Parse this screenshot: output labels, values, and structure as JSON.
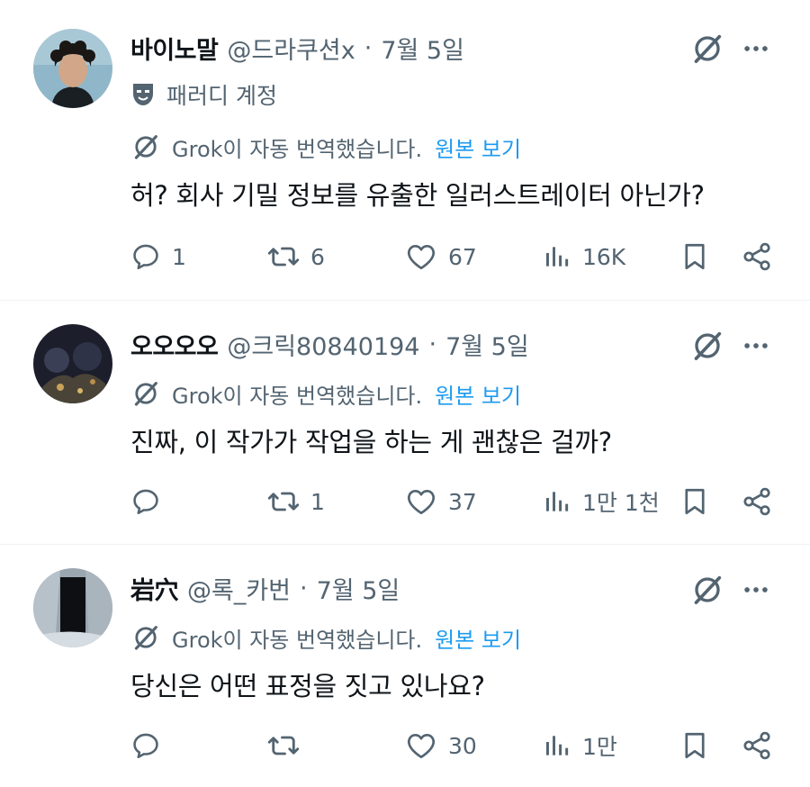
{
  "replies": [
    {
      "name": "바이노말",
      "handle": "@드라쿠션x",
      "dot": "·",
      "date": "7월 5일",
      "parody_label": "패러디 계정",
      "translate_note": "Grok이 자동 번역했습니다.",
      "view_original": "원본 보기",
      "text": "허? 회사 기밀 정보를 유출한 일러스트레이터 아닌가?",
      "replies_count": "1",
      "reposts_count": "6",
      "likes_count": "67",
      "views_count": "16K"
    },
    {
      "name": "오오오오",
      "handle": "@크릭80840194",
      "dot": "·",
      "date": "7월 5일",
      "translate_note": "Grok이 자동 번역했습니다.",
      "view_original": "원본 보기",
      "text": "진짜, 이 작가가 작업을 하는 게 괜찮은 걸까?",
      "replies_count": "",
      "reposts_count": "1",
      "likes_count": "37",
      "views_count": "1만 1천"
    },
    {
      "name": "岩穴",
      "handle": "@록_카번",
      "dot": "·",
      "date": "7월 5일",
      "translate_note": "Grok이 자동 번역했습니다.",
      "view_original": "원본 보기",
      "text": "당신은 어떤 표정을 짓고 있나요?",
      "replies_count": "",
      "reposts_count": "",
      "likes_count": "30",
      "views_count": "1만"
    }
  ],
  "icons": {
    "reply": "reply-icon",
    "repost": "repost-icon",
    "like": "heart-icon",
    "views": "views-icon",
    "bookmark": "bookmark-icon",
    "share": "share-icon",
    "grok": "grok-icon",
    "more": "more-icon",
    "parody": "parody-mask-icon"
  },
  "colors": {
    "text": "#0f1419",
    "secondary": "#536471",
    "link": "#1d9bf0",
    "divider": "#eff3f4"
  }
}
